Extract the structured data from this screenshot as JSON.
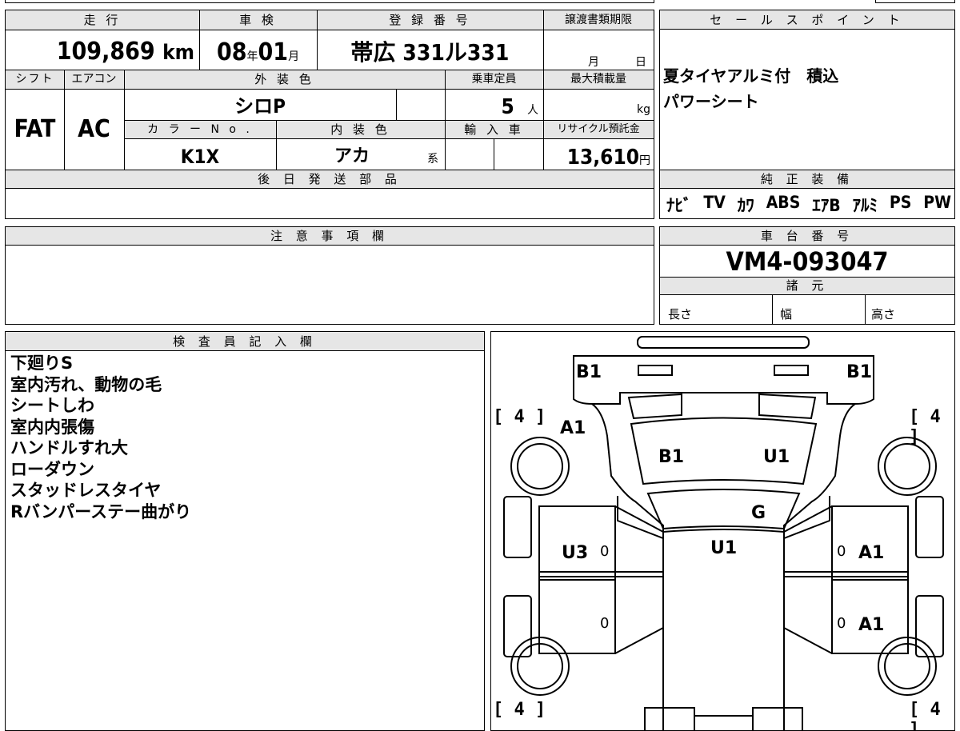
{
  "top_info": {
    "headers": {
      "mileage": "走 行",
      "inspection": "車 検",
      "registration": "登 録 番 号",
      "transfer_deadline": "譲渡書類期限",
      "shift": "シフト",
      "aircon": "エアコン",
      "exterior_color": "外 装 色",
      "capacity": "乗車定員",
      "max_load": "最大積載量",
      "color_no": "カ ラ ー N o .",
      "interior_color": "内 装 色",
      "import": "輸 入 車",
      "recycle": "リサイクル預託金"
    },
    "mileage": "109,869",
    "mileage_unit": "km",
    "inspection_year": "08",
    "year_unit": "年",
    "inspection_month": "01",
    "month_unit": "月",
    "registration_number": "帯広 331ル331",
    "deadline_month_unit": "月",
    "deadline_day_unit": "日",
    "shift": "FAT",
    "aircon": "AC",
    "exterior_color": "シロP",
    "capacity": "5",
    "capacity_unit": "人",
    "max_load_unit": "kg",
    "color_no": "K1X",
    "interior_color": "アカ",
    "interior_suffix": "系",
    "recycle_fee": "13,610",
    "recycle_unit": "円"
  },
  "later_parts": {
    "header": "後 日 発 送 部 品"
  },
  "sales_point": {
    "header": "セ ー ル ス ポ イ ン ト",
    "lines": [
      "夏タイヤアルミ付　積込",
      "パワーシート"
    ]
  },
  "equipment": {
    "header": "純 正 装 備",
    "items": [
      "ﾅﾋﾞ",
      "TV",
      "ｶﾜ",
      "ABS",
      "ｴｱB",
      "ｱﾙﾐ",
      "PS",
      "PW"
    ]
  },
  "notes": {
    "header": "注 意 事 項 欄"
  },
  "chassis": {
    "header": "車 台 番 号",
    "number": "VM4-093047",
    "specs_header": "諸 元",
    "length": "長さ",
    "width": "幅",
    "height": "高さ"
  },
  "inspector": {
    "header": "検 査 員 記 入 欄",
    "lines": [
      "下廻りS",
      "室内汚れ、動物の毛",
      "シートしわ",
      "室内内張傷",
      "ハンドルすれ大",
      "ローダウン",
      "スタッドレスタイヤ",
      "Rバンパーステー曲がり"
    ]
  },
  "diagram": {
    "marks": {
      "rear_left": "B1",
      "rear_right": "B1",
      "rear_quarter_left": "A1",
      "roof_left": "B1",
      "roof_right": "U1",
      "glass": "G",
      "hood": "U1",
      "door_left": "U3",
      "door_right_front": "A1",
      "door_right_rear": "A1",
      "zero_1": "0",
      "zero_2": "0",
      "zero_3": "0",
      "zero_4": "0"
    },
    "tires": {
      "rl": "4",
      "rr": "4",
      "fl": "4",
      "fr": "4"
    }
  }
}
